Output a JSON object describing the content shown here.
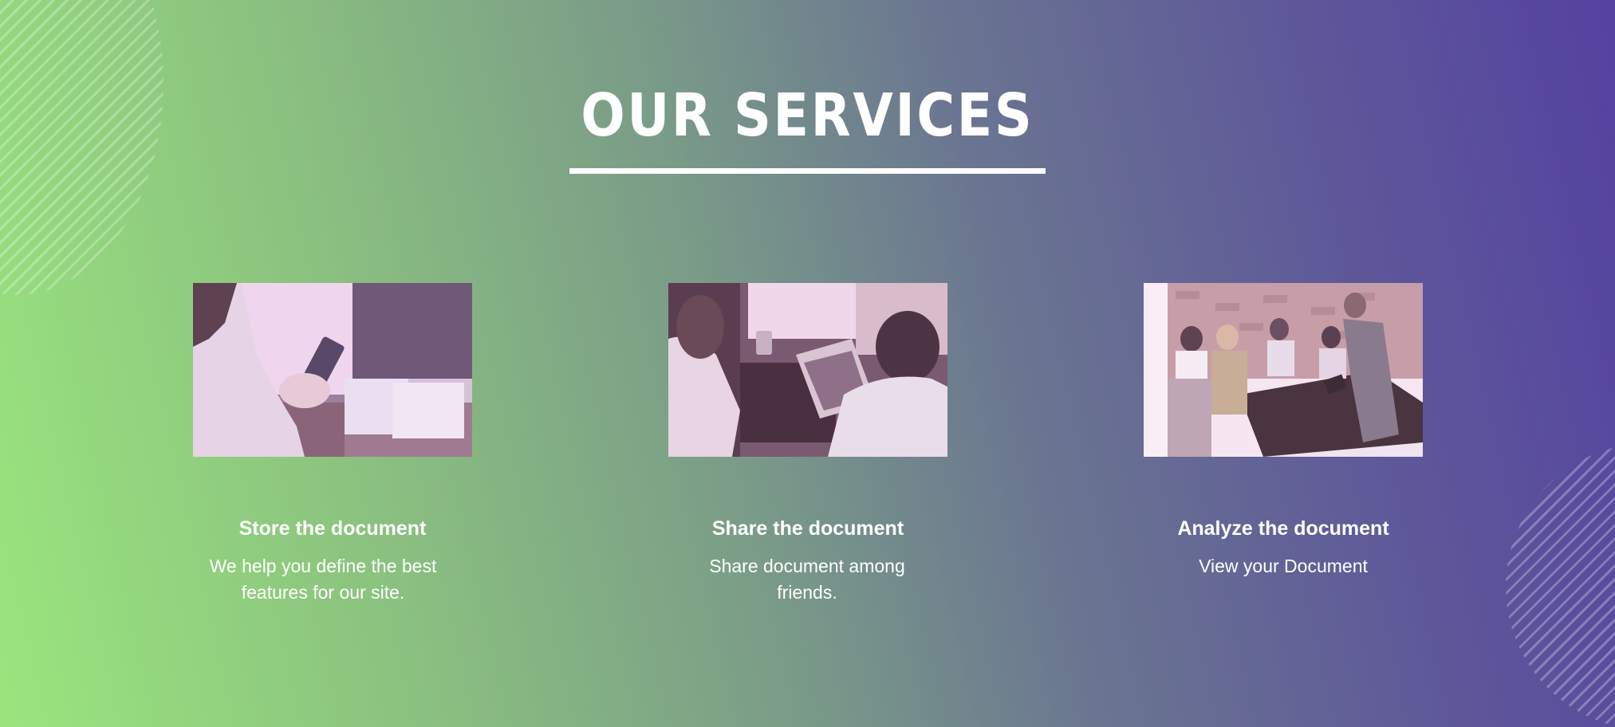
{
  "section": {
    "title": "OUR SERVICES",
    "cards": [
      {
        "heading": "Store the document",
        "description": "We help you define the best features for our site.",
        "image_icon": "photo-woman-using-phone"
      },
      {
        "heading": "Share the document",
        "description": "Share document among friends.",
        "image_icon": "photo-people-sharing-documents"
      },
      {
        "heading": "Analyze the document",
        "description": "View your Document",
        "image_icon": "photo-team-meeting"
      }
    ]
  },
  "colors": {
    "gradient_start": "#9ae57e",
    "gradient_end": "#5442a0",
    "text": "#ffffff",
    "photo_tint": "#f2c9e6"
  }
}
